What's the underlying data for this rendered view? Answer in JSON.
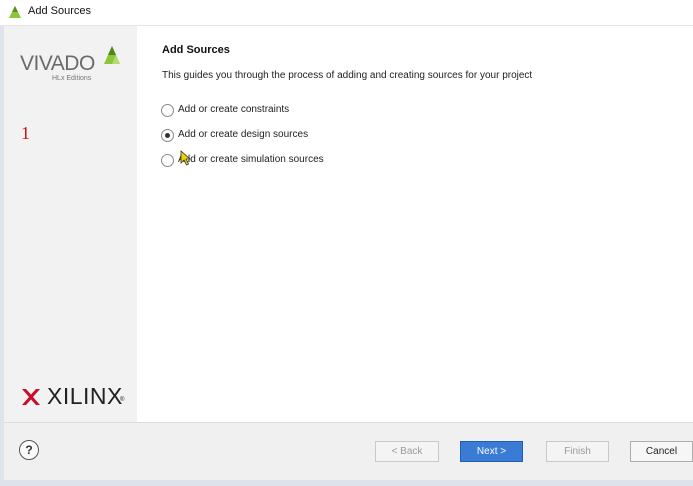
{
  "window": {
    "title": "Add Sources",
    "icon": "vivado-leaf-icon"
  },
  "sidebar": {
    "brand_top": "VIVADO",
    "brand_sub": "HLx Editions",
    "step_marker": "1",
    "brand_bottom": "XILINX",
    "brand_bottom_mark": "®"
  },
  "main": {
    "heading": "Add Sources",
    "description": "This guides you through the process of adding and creating sources for your project",
    "options": [
      {
        "label": "Add or create constraints",
        "selected": false
      },
      {
        "label": "Add or create design sources",
        "selected": true
      },
      {
        "label": "Add or create simulation sources",
        "selected": false
      }
    ]
  },
  "footer": {
    "help_symbol": "?",
    "back_label": "< Back",
    "next_label": "Next >",
    "finish_label": "Finish",
    "cancel_label": "Cancel"
  },
  "colors": {
    "accent": "#3a7bd5",
    "step_marker": "#cc1111",
    "vivado_leaf": "#8cc63f"
  }
}
